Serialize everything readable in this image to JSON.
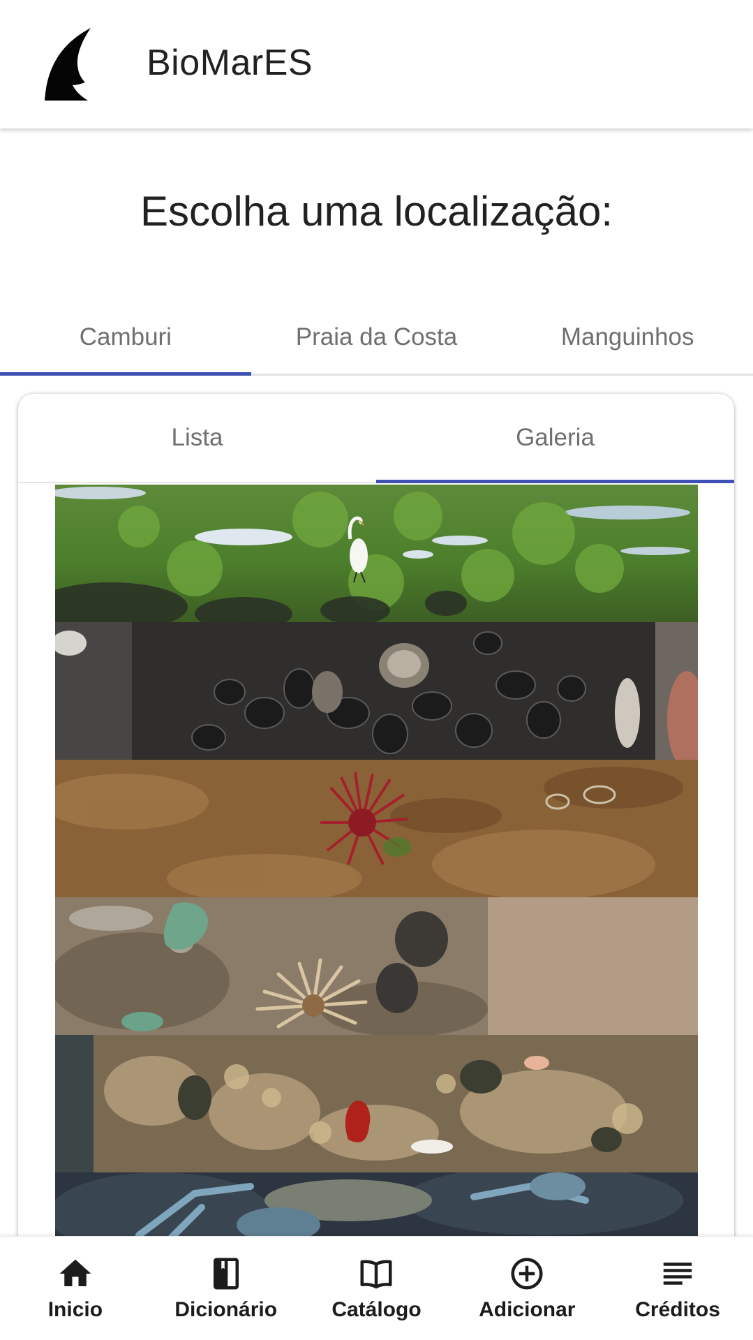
{
  "app": {
    "title": "BioMarES",
    "logo": "shark-fin-logo"
  },
  "page": {
    "heading": "Escolha uma localização:"
  },
  "location_tabs": [
    {
      "label": "Camburi",
      "active": true
    },
    {
      "label": "Praia da Costa",
      "active": false
    },
    {
      "label": "Manguinhos",
      "active": false
    }
  ],
  "view_tabs": [
    {
      "label": "Lista",
      "active": false
    },
    {
      "label": "Galeria",
      "active": true
    }
  ],
  "gallery": {
    "photos": [
      "egret-on-algae-rocks",
      "mussels-on-rock",
      "red-sea-anemone",
      "brown-sea-anemone",
      "red-anemone-in-crevice",
      "crab-on-dark-rock"
    ]
  },
  "bottom_nav": [
    {
      "label": "Inicio",
      "icon": "home-icon"
    },
    {
      "label": "Dicionário",
      "icon": "book-icon"
    },
    {
      "label": "Catálogo",
      "icon": "open-book-icon"
    },
    {
      "label": "Adicionar",
      "icon": "add-circle-icon"
    },
    {
      "label": "Créditos",
      "icon": "list-icon"
    }
  ],
  "colors": {
    "accent": "#3f51b5",
    "tab_text": "#6f6f6f",
    "text": "#212121"
  }
}
